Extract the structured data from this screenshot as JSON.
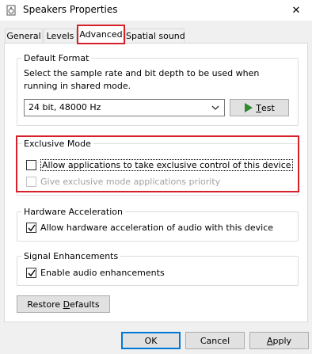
{
  "window": {
    "title": "Speakers Properties",
    "close_glyph": "✕"
  },
  "tabs": [
    {
      "label": "General",
      "active": false
    },
    {
      "label": "Levels",
      "active": false
    },
    {
      "label": "Advanced",
      "active": true
    },
    {
      "label": "Spatial sound",
      "active": false
    }
  ],
  "default_format": {
    "legend": "Default Format",
    "description": "Select the sample rate and bit depth to be used when running in shared mode.",
    "selected": "24 bit, 48000 Hz",
    "test_button": {
      "first": "T",
      "rest": "est"
    }
  },
  "exclusive_mode": {
    "legend": "Exclusive Mode",
    "option1": {
      "label": "Allow applications to take exclusive control of this device",
      "checked": false,
      "enabled": true
    },
    "option2": {
      "label": "Give exclusive mode applications priority",
      "checked": false,
      "enabled": false
    }
  },
  "hardware_acceleration": {
    "legend": "Hardware Acceleration",
    "option": {
      "label": "Allow hardware acceleration of audio with this device",
      "checked": true
    }
  },
  "signal_enhancements": {
    "legend": "Signal Enhancements",
    "option": {
      "label": "Enable audio enhancements",
      "checked": true
    }
  },
  "buttons": {
    "restore_defaults": {
      "first": "Restore ",
      "underlined": "D",
      "rest": "efaults"
    },
    "ok": "OK",
    "cancel": "Cancel",
    "apply": {
      "underlined": "A",
      "rest": "pply"
    }
  },
  "colors": {
    "highlight": "#d6202a",
    "play_icon": "#2e8b2e",
    "primary_border": "#0078d7"
  }
}
